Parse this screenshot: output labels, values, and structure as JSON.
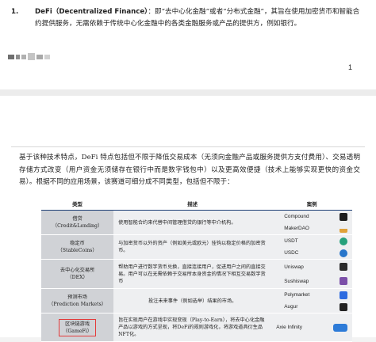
{
  "page1": {
    "item_number": "1.",
    "item_title": "DeFi（Decentralized Finance）",
    "item_text": "：即“去中心化金融”或者“分布式金融”，其旨在使用加密货币和智能合约提供服务，无需依赖于传统中心化金融中的各类金融服务或产品的提供方，例如银行。",
    "page_number": "1"
  },
  "page2": {
    "intro": "基于该种技术特点，DeFi 特点包括但不限于降低交易成本（无须向金融产品或服务提供方支付费用）、交易透明存储方式改变（用户资金无须储存在银行中而是数字钱包中）以及更高效便捷（技术上能够实现更快的资金交易）。根据不同的应用场景，该赛道可细分成不同类型，包括但不限于：",
    "table": {
      "headers": [
        "类型",
        "描述",
        "案例"
      ],
      "rows": [
        {
          "type_cn": "借贷",
          "type_en": "（Credit&Lending）",
          "desc": "使用智能合约来代替中间管理借贷的银行等中介机构。",
          "examples": [
            {
              "name": "Compound",
              "icon": "compound-icon",
              "color": "#1d1d1d"
            },
            {
              "name": "MakerDAO",
              "icon": "makerdao-icon",
              "color": "#e0a23a"
            }
          ]
        },
        {
          "type_cn": "稳定币",
          "type_en": "（StableCoins）",
          "desc": "与加密货币以外的资产（例如美元或欧元）挂钩以稳定价格的加密货币。",
          "examples": [
            {
              "name": "USDT",
              "icon": "usdt-icon",
              "color": "#26a17b"
            },
            {
              "name": "USDC",
              "icon": "usdc-icon",
              "color": "#2775ca"
            }
          ]
        },
        {
          "type_cn": "去中心化交易所",
          "type_en": "（DEX）",
          "desc": "帮助用户进行数字货币兑换，直接连接用户，促进用户之间的直接交易。用户可以在无需依赖于交易所本身资金的情况下相互交易数字货币",
          "examples": [
            {
              "name": "Uniswap",
              "icon": "uniswap-icon",
              "color": "#2b2b2b"
            },
            {
              "name": "Sushiswap",
              "icon": "sushiswap-icon",
              "color": "#7b4fa8"
            }
          ]
        },
        {
          "type_cn": "预测市场",
          "type_en": "（Prediction Markets）",
          "desc": "投注未来事件（例如选举）结果的市场。",
          "examples": [
            {
              "name": "Polymarket",
              "icon": "polymarket-icon",
              "color": "#2d6be0"
            },
            {
              "name": "Augur",
              "icon": "augur-icon",
              "color": "#222222"
            }
          ]
        },
        {
          "type_cn": "区块链游戏",
          "type_en": "（GameFi）",
          "desc": "旨在实现用户在游戏中实现变现（Play-to-Earn），将去中心化金融产品以游戏的方式呈现，将DeFi的规则游戏化，将游戏道具衍生品NFT化。",
          "examples": [
            {
              "name": "Axie Infinity",
              "icon": "axie-icon",
              "color": "#2d7bd8"
            }
          ]
        }
      ]
    }
  }
}
